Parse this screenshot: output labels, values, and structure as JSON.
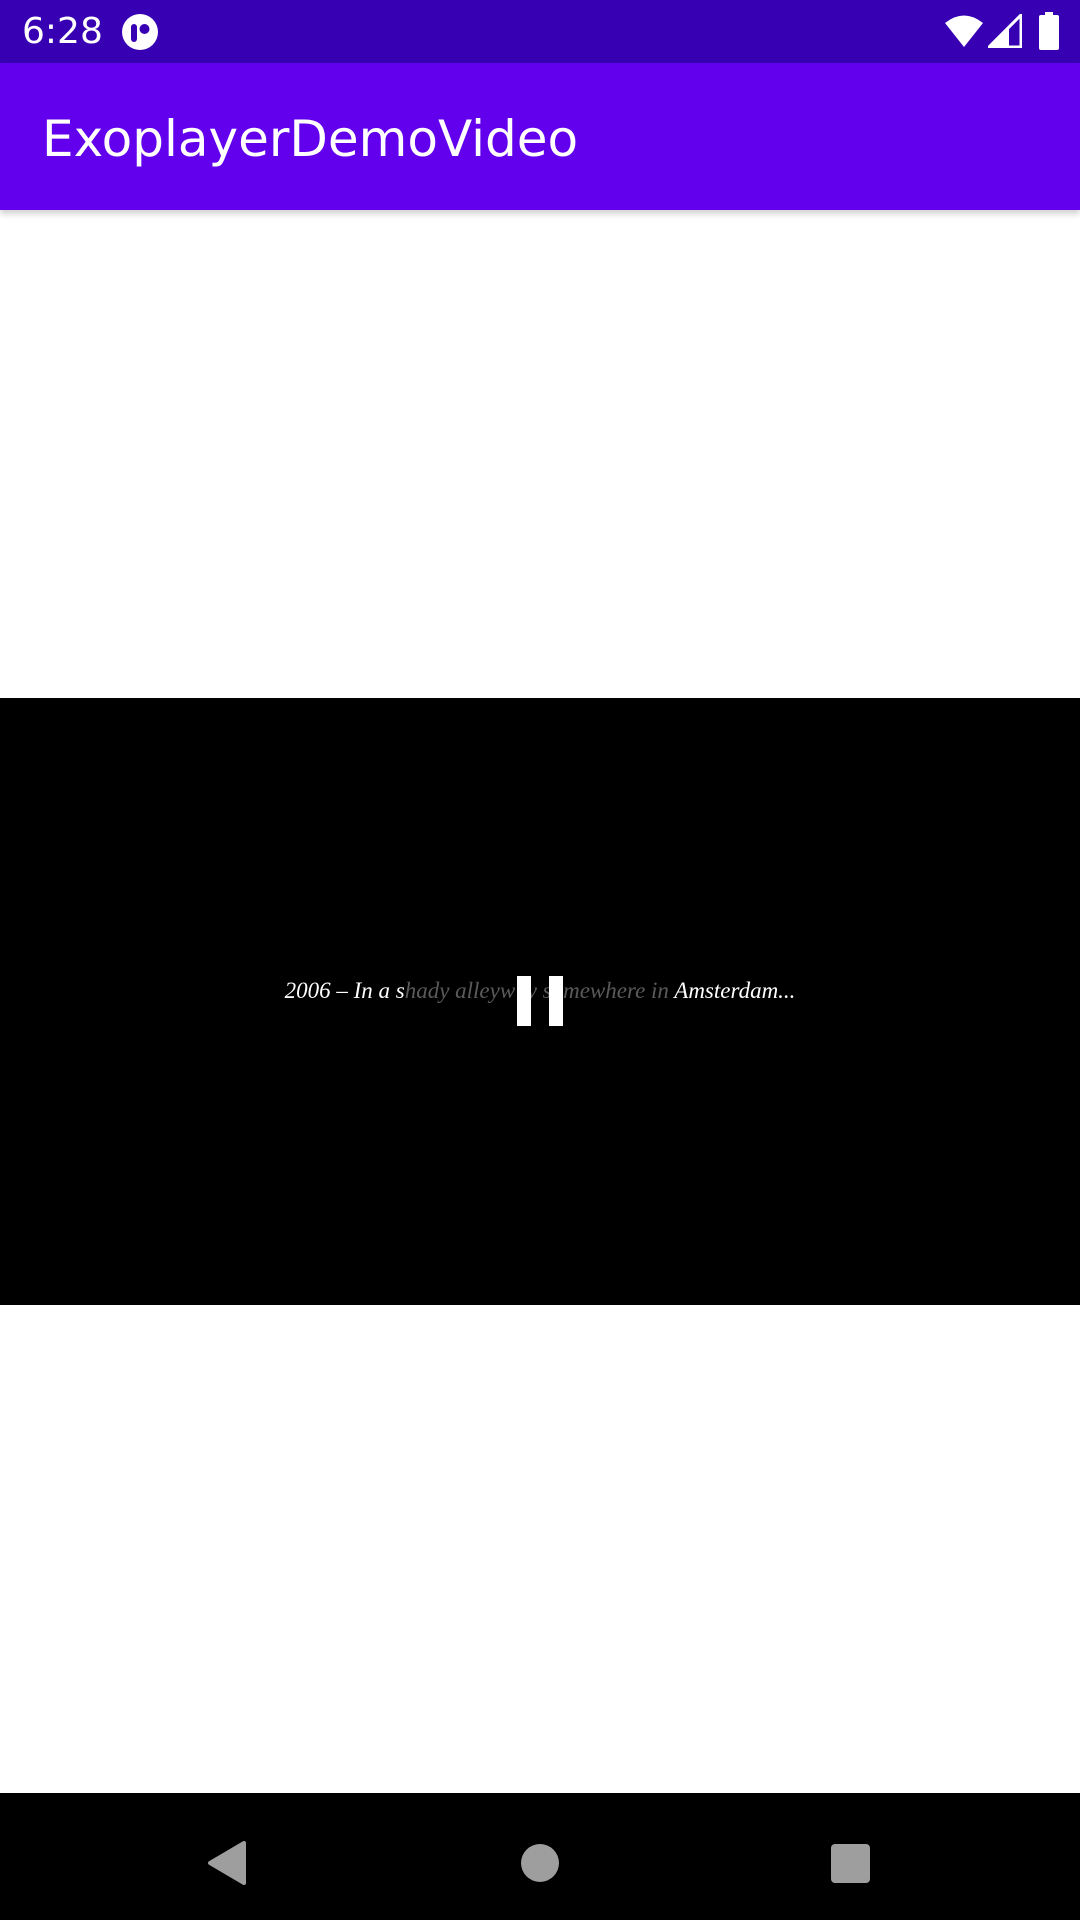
{
  "status_bar": {
    "time": "6:28",
    "icons": [
      "app-notification-icon",
      "wifi-icon",
      "cell-signal-icon",
      "battery-icon"
    ],
    "background": "#3700b3"
  },
  "app_bar": {
    "title": "ExoplayerDemoVideo",
    "background": "#6200ee"
  },
  "player": {
    "subtitle_segments": [
      {
        "text": "2006 – In a s",
        "style": "bright"
      },
      {
        "text": "hady alleyw",
        "style": "dim"
      },
      {
        "text": "a",
        "style": "hidden"
      },
      {
        "text": "y s",
        "style": "dim"
      },
      {
        "text": "o",
        "style": "hidden"
      },
      {
        "text": "mewhere in ",
        "style": "dim"
      },
      {
        "text": "Amsterdam...",
        "style": "bright"
      }
    ],
    "control_icon": "pause-icon",
    "background": "#000000"
  },
  "nav_bar": {
    "buttons": [
      "back-icon",
      "home-icon",
      "recents-icon"
    ],
    "background": "#000000"
  }
}
